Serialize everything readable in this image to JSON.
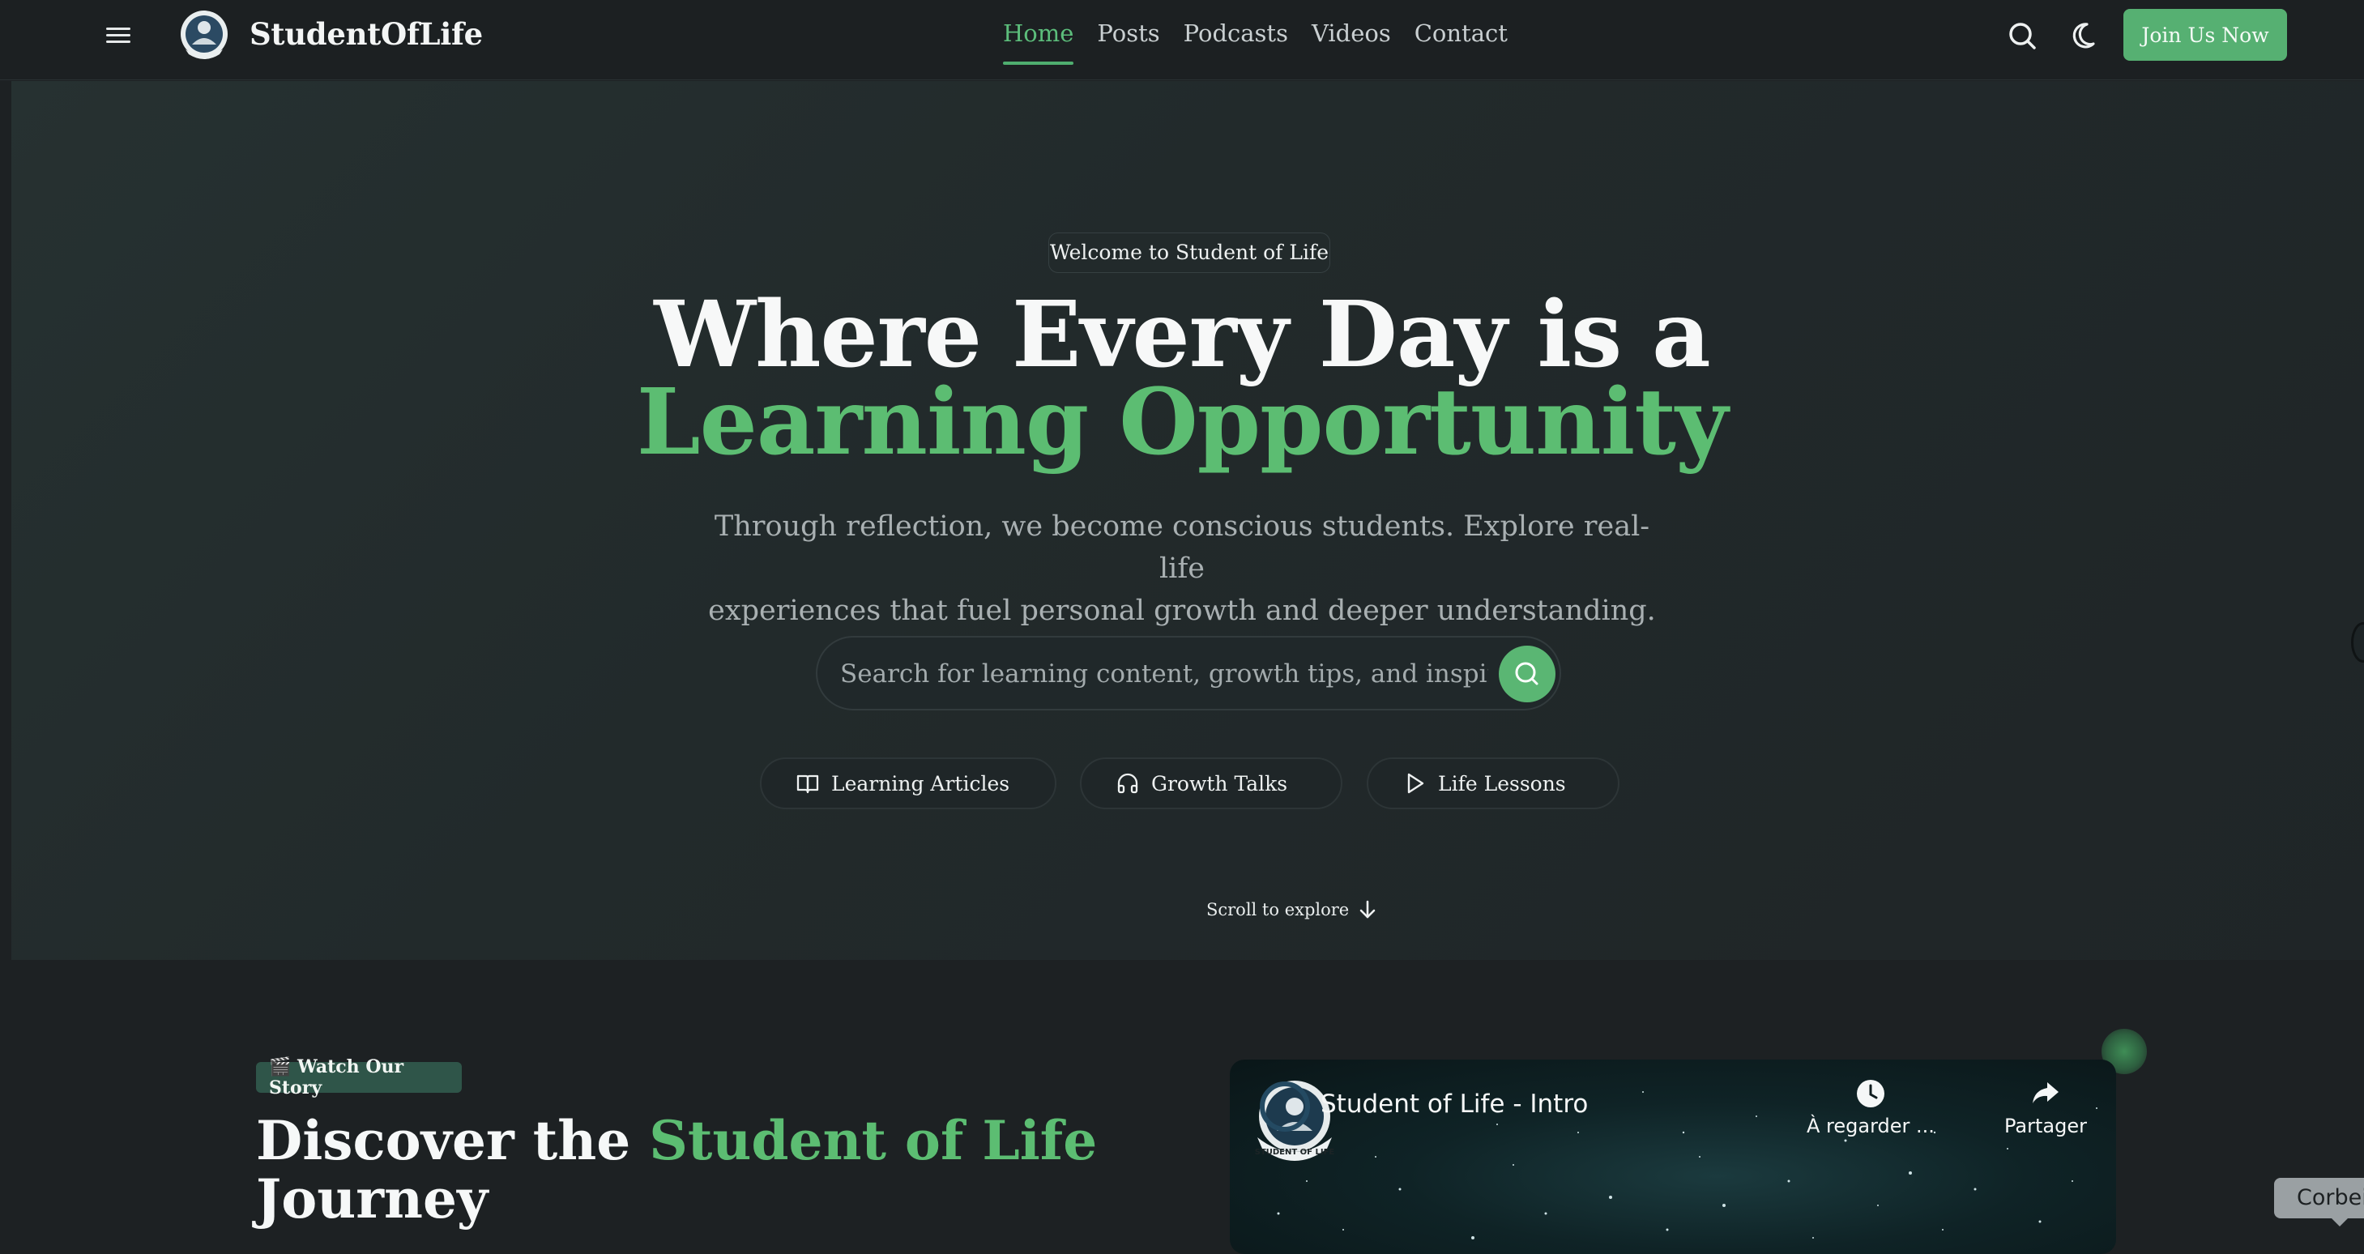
{
  "nav": {
    "brand": "StudentOfLife",
    "links": [
      {
        "label": "Home",
        "active": true
      },
      {
        "label": "Posts"
      },
      {
        "label": "Podcasts"
      },
      {
        "label": "Videos"
      },
      {
        "label": "Contact"
      }
    ],
    "cta_label": "Join Us Now",
    "icons": [
      "menu-icon",
      "search-icon",
      "moon-icon"
    ]
  },
  "hero": {
    "pill": "Welcome to Student of Life",
    "headline_line1": "Where Every Day is a",
    "headline_line2": "Learning Opportunity",
    "subtitle_line1": "Through reflection, we become conscious students. Explore real-life",
    "subtitle_line2": "experiences that fuel personal growth and deeper understanding.",
    "search_placeholder": "Search for learning content, growth tips, and inspiration",
    "categories": [
      {
        "label": "Learning Articles",
        "icon": "book-open-icon"
      },
      {
        "label": "Growth Talks",
        "icon": "headphones-icon"
      },
      {
        "label": "Life Lessons",
        "icon": "play-icon"
      }
    ],
    "scroll_label": "Scroll to explore"
  },
  "story": {
    "tag": "🎬 Watch Our Story",
    "title_part1": "Discover the ",
    "title_highlight": "Student of Life",
    "title_part2": "Journey"
  },
  "video": {
    "title": "Student of Life - Intro",
    "watch_later": "À regarder ...",
    "share": "Partager",
    "badge_text": "STUDENT OF LIFE"
  },
  "tooltip": "Corbeille",
  "colors": {
    "accent": "#5cbd72",
    "cta": "#56b072",
    "background": "#1d2123",
    "hero_bg": "#263131",
    "tag_bg": "#2f5549"
  }
}
